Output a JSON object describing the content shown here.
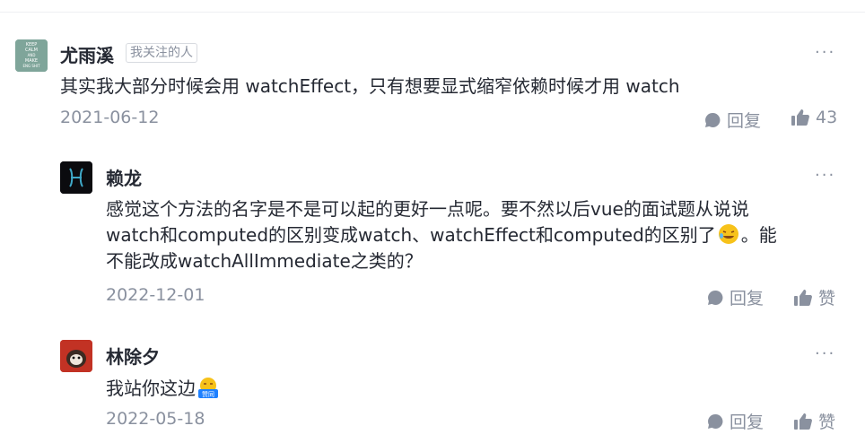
{
  "comments": [
    {
      "username": "尤雨溪",
      "badge": "我关注的人",
      "avatar_text": [
        "KEEP",
        "CALM",
        "AND",
        "MAKE",
        "ENG SHIT"
      ],
      "content": "其实我大部分时候会用 watchEffect，只有想要显式缩窄依赖时候才用 watch",
      "date": "2021-06-12",
      "reply_label": "回复",
      "like_label": "43",
      "more_label": "···"
    },
    {
      "username": "赖龙",
      "content_lines": [
        "感觉这个方法的名字是不是可以起的更好一点呢。要不然以后vue的面试题从说说",
        "watch和computed的区别变成watch、watchEffect和computed的区别了",
        "。能",
        "不能改成watchAllImmediate之类的？"
      ],
      "date": "2022-12-01",
      "reply_label": "回复",
      "like_label": "赞",
      "more_label": "···"
    },
    {
      "username": "林除夕",
      "content": "我站你这边",
      "date": "2022-05-18",
      "reply_label": "回复",
      "like_label": "赞",
      "more_label": "···"
    }
  ],
  "emoji_badge_text": "赞同",
  "colors": {
    "text": "#252933",
    "muted": "#8a919f",
    "border": "#d8dbe0",
    "emoji": "#f7c21a",
    "badge": "#1e80ff"
  }
}
